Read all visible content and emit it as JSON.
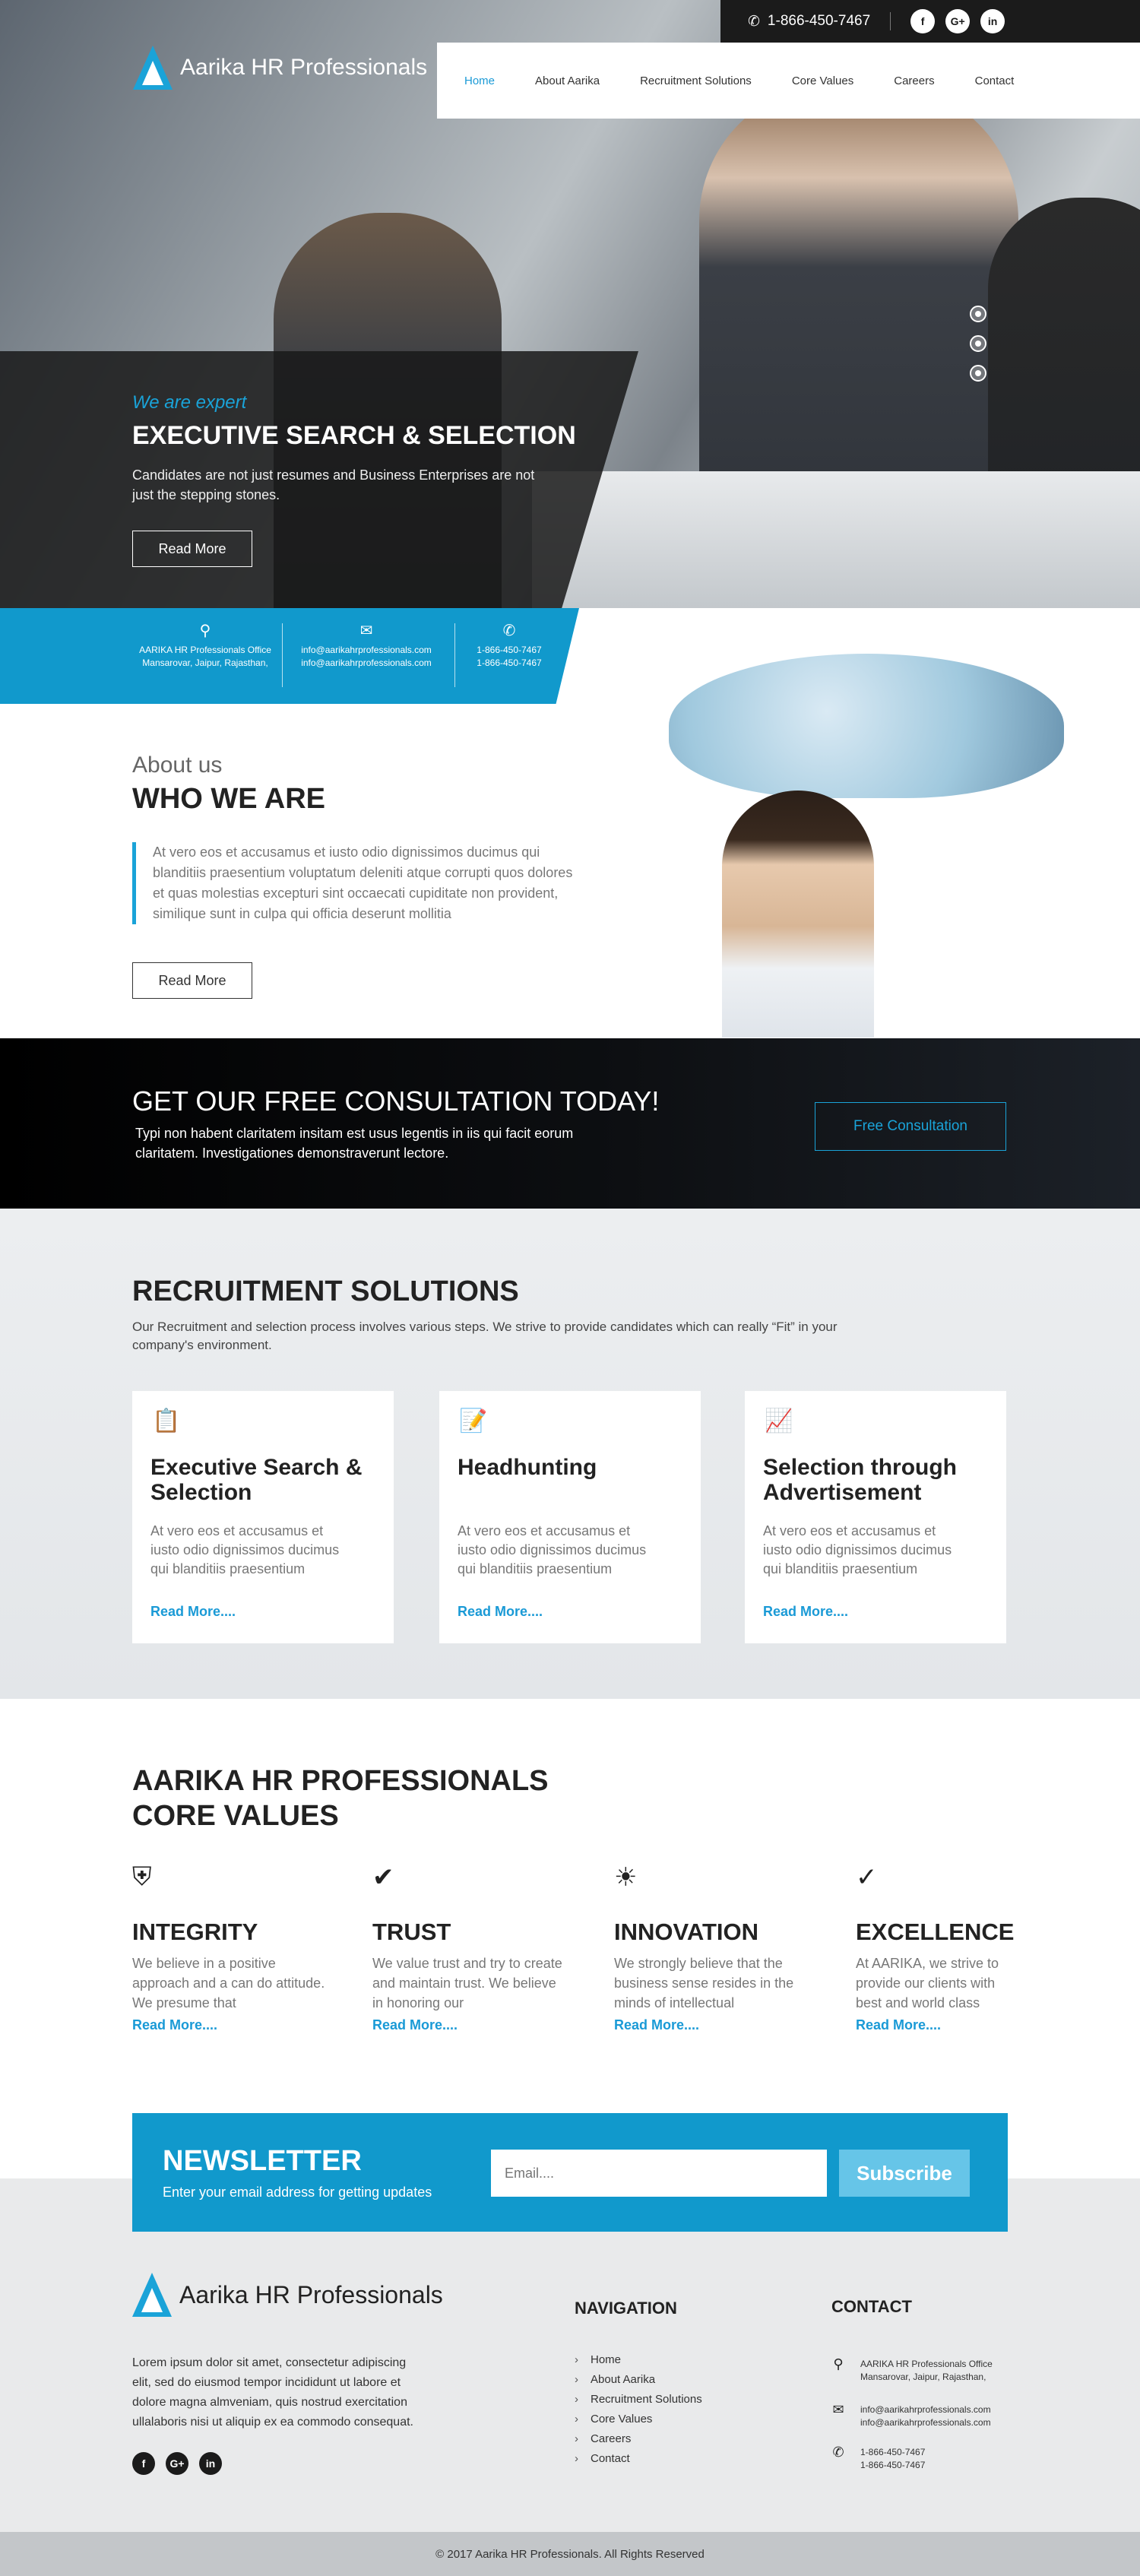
{
  "topbar": {
    "phone": "1-866-450-7467"
  },
  "brand": {
    "name": "Aarika HR Professionals"
  },
  "nav": [
    "Home",
    "About Aarika",
    "Recruitment Solutions",
    "Core Values",
    "Careers",
    "Contact"
  ],
  "hero": {
    "tagline": "We are expert",
    "title": "EXECUTIVE SEARCH & SELECTION",
    "text": "Candidates are not just resumes and Business Enterprises are not just the stepping stones.",
    "button": "Read More"
  },
  "info": {
    "address1": "AARIKA HR Professionals Office",
    "address2": "Mansarovar, Jaipur, Rajasthan,",
    "email1": "info@aarikahrprofessionals.com",
    "email2": "info@aarikahrprofessionals.com",
    "phone1": "1-866-450-7467",
    "phone2": "1-866-450-7467"
  },
  "about": {
    "small": "About us",
    "title": "WHO WE ARE",
    "text": "At vero eos et accusamus et iusto odio dignissimos ducimus qui blanditiis praesentium voluptatum deleniti atque corrupti quos dolores et quas molestias excepturi sint occaecati cupiditate non provident, similique sunt in culpa qui officia deserunt mollitia",
    "button": "Read More"
  },
  "consult": {
    "title": "GET OUR FREE CONSULTATION TODAY!",
    "text": "Typi non habent claritatem insitam est usus legentis in iis qui facit eorum claritatem. Investigationes demonstraverunt lectore.",
    "button": "Free Consultation"
  },
  "recruit": {
    "title": "RECRUITMENT SOLUTIONS",
    "text": "Our Recruitment and selection process involves various steps. We strive to provide candidates which can really “Fit” in your company's environment.",
    "cards": [
      {
        "title": "Executive Search & Selection",
        "text": "At vero eos et accusamus et iusto odio dignissimos ducimus qui blanditiis praesentium",
        "link": "Read More....",
        "icon": "clipboard-chart-icon"
      },
      {
        "title": "Headhunting",
        "text": "At vero eos et accusamus et iusto odio dignissimos ducimus qui blanditiis praesentium",
        "link": "Read More....",
        "icon": "document-pen-icon"
      },
      {
        "title": "Selection through Advertisement",
        "text": "At vero eos et accusamus et iusto odio dignissimos ducimus qui blanditiis praesentium",
        "link": "Read More....",
        "icon": "line-chart-icon"
      }
    ]
  },
  "core": {
    "title1": "AARIKA HR PROFESSIONALS",
    "title2": "CORE VALUES",
    "values": [
      {
        "title": "INTEGRITY",
        "text": "We believe in a positive approach and a can do attitude. We presume that",
        "link": "Read More....",
        "icon": "shield-icon"
      },
      {
        "title": "TRUST",
        "text": "We value trust and try to create and maintain trust. We believe in honoring our",
        "link": "Read More....",
        "icon": "badge-check-icon"
      },
      {
        "title": "INNOVATION",
        "text": "We strongly believe that the business sense resides in the minds of intellectual",
        "link": "Read More....",
        "icon": "lightbulb-icon"
      },
      {
        "title": "EXCELLENCE",
        "text": "At AARIKA, we strive to provide our clients with best and world class",
        "link": "Read More....",
        "icon": "check-circle-icon"
      }
    ]
  },
  "newsletter": {
    "title": "NEWSLETTER",
    "text": "Enter your email address for getting updates",
    "placeholder": "Email....",
    "button": "Subscribe"
  },
  "footer": {
    "about": "Lorem ipsum dolor sit amet, consectetur adipiscing elit, sed do eiusmod tempor incididunt ut labore et dolore magna almveniam, quis nostrud exercitation ullalaboris nisi ut aliquip ex ea commodo consequat.",
    "nav_title": "NAVIGATION",
    "nav": [
      "Home",
      "About Aarika",
      "Recruitment Solutions",
      "Core Values",
      "Careers",
      "Contact"
    ],
    "contact_title": "CONTACT",
    "copyright": "© 2017 Aarika HR Professionals. All Rights Reserved"
  },
  "colors": {
    "accent": "#1199cc",
    "link": "#1a9ad6",
    "dark": "#1b1b1b"
  }
}
